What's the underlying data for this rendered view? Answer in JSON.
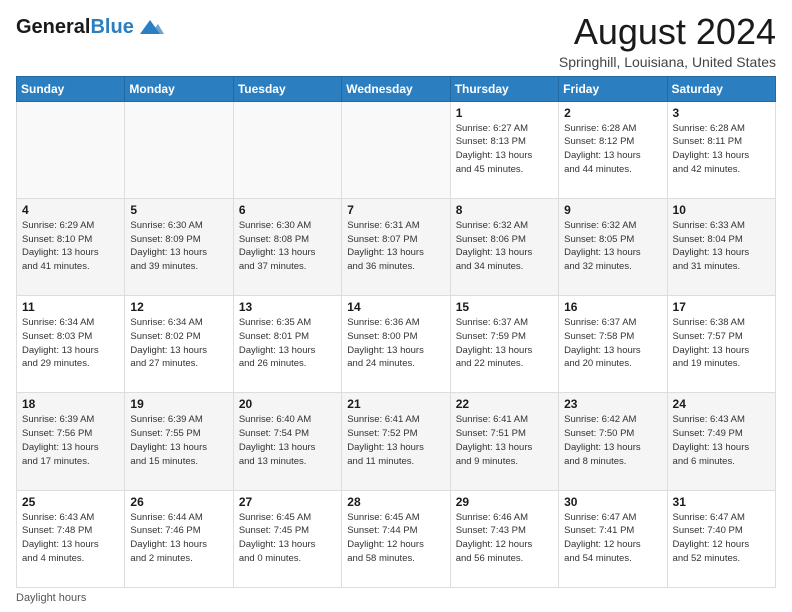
{
  "header": {
    "logo_line1": "General",
    "logo_line2": "Blue",
    "month_title": "August 2024",
    "location": "Springhill, Louisiana, United States"
  },
  "days_of_week": [
    "Sunday",
    "Monday",
    "Tuesday",
    "Wednesday",
    "Thursday",
    "Friday",
    "Saturday"
  ],
  "weeks": [
    [
      {
        "day": "",
        "info": ""
      },
      {
        "day": "",
        "info": ""
      },
      {
        "day": "",
        "info": ""
      },
      {
        "day": "",
        "info": ""
      },
      {
        "day": "1",
        "info": "Sunrise: 6:27 AM\nSunset: 8:13 PM\nDaylight: 13 hours\nand 45 minutes."
      },
      {
        "day": "2",
        "info": "Sunrise: 6:28 AM\nSunset: 8:12 PM\nDaylight: 13 hours\nand 44 minutes."
      },
      {
        "day": "3",
        "info": "Sunrise: 6:28 AM\nSunset: 8:11 PM\nDaylight: 13 hours\nand 42 minutes."
      }
    ],
    [
      {
        "day": "4",
        "info": "Sunrise: 6:29 AM\nSunset: 8:10 PM\nDaylight: 13 hours\nand 41 minutes."
      },
      {
        "day": "5",
        "info": "Sunrise: 6:30 AM\nSunset: 8:09 PM\nDaylight: 13 hours\nand 39 minutes."
      },
      {
        "day": "6",
        "info": "Sunrise: 6:30 AM\nSunset: 8:08 PM\nDaylight: 13 hours\nand 37 minutes."
      },
      {
        "day": "7",
        "info": "Sunrise: 6:31 AM\nSunset: 8:07 PM\nDaylight: 13 hours\nand 36 minutes."
      },
      {
        "day": "8",
        "info": "Sunrise: 6:32 AM\nSunset: 8:06 PM\nDaylight: 13 hours\nand 34 minutes."
      },
      {
        "day": "9",
        "info": "Sunrise: 6:32 AM\nSunset: 8:05 PM\nDaylight: 13 hours\nand 32 minutes."
      },
      {
        "day": "10",
        "info": "Sunrise: 6:33 AM\nSunset: 8:04 PM\nDaylight: 13 hours\nand 31 minutes."
      }
    ],
    [
      {
        "day": "11",
        "info": "Sunrise: 6:34 AM\nSunset: 8:03 PM\nDaylight: 13 hours\nand 29 minutes."
      },
      {
        "day": "12",
        "info": "Sunrise: 6:34 AM\nSunset: 8:02 PM\nDaylight: 13 hours\nand 27 minutes."
      },
      {
        "day": "13",
        "info": "Sunrise: 6:35 AM\nSunset: 8:01 PM\nDaylight: 13 hours\nand 26 minutes."
      },
      {
        "day": "14",
        "info": "Sunrise: 6:36 AM\nSunset: 8:00 PM\nDaylight: 13 hours\nand 24 minutes."
      },
      {
        "day": "15",
        "info": "Sunrise: 6:37 AM\nSunset: 7:59 PM\nDaylight: 13 hours\nand 22 minutes."
      },
      {
        "day": "16",
        "info": "Sunrise: 6:37 AM\nSunset: 7:58 PM\nDaylight: 13 hours\nand 20 minutes."
      },
      {
        "day": "17",
        "info": "Sunrise: 6:38 AM\nSunset: 7:57 PM\nDaylight: 13 hours\nand 19 minutes."
      }
    ],
    [
      {
        "day": "18",
        "info": "Sunrise: 6:39 AM\nSunset: 7:56 PM\nDaylight: 13 hours\nand 17 minutes."
      },
      {
        "day": "19",
        "info": "Sunrise: 6:39 AM\nSunset: 7:55 PM\nDaylight: 13 hours\nand 15 minutes."
      },
      {
        "day": "20",
        "info": "Sunrise: 6:40 AM\nSunset: 7:54 PM\nDaylight: 13 hours\nand 13 minutes."
      },
      {
        "day": "21",
        "info": "Sunrise: 6:41 AM\nSunset: 7:52 PM\nDaylight: 13 hours\nand 11 minutes."
      },
      {
        "day": "22",
        "info": "Sunrise: 6:41 AM\nSunset: 7:51 PM\nDaylight: 13 hours\nand 9 minutes."
      },
      {
        "day": "23",
        "info": "Sunrise: 6:42 AM\nSunset: 7:50 PM\nDaylight: 13 hours\nand 8 minutes."
      },
      {
        "day": "24",
        "info": "Sunrise: 6:43 AM\nSunset: 7:49 PM\nDaylight: 13 hours\nand 6 minutes."
      }
    ],
    [
      {
        "day": "25",
        "info": "Sunrise: 6:43 AM\nSunset: 7:48 PM\nDaylight: 13 hours\nand 4 minutes."
      },
      {
        "day": "26",
        "info": "Sunrise: 6:44 AM\nSunset: 7:46 PM\nDaylight: 13 hours\nand 2 minutes."
      },
      {
        "day": "27",
        "info": "Sunrise: 6:45 AM\nSunset: 7:45 PM\nDaylight: 13 hours\nand 0 minutes."
      },
      {
        "day": "28",
        "info": "Sunrise: 6:45 AM\nSunset: 7:44 PM\nDaylight: 12 hours\nand 58 minutes."
      },
      {
        "day": "29",
        "info": "Sunrise: 6:46 AM\nSunset: 7:43 PM\nDaylight: 12 hours\nand 56 minutes."
      },
      {
        "day": "30",
        "info": "Sunrise: 6:47 AM\nSunset: 7:41 PM\nDaylight: 12 hours\nand 54 minutes."
      },
      {
        "day": "31",
        "info": "Sunrise: 6:47 AM\nSunset: 7:40 PM\nDaylight: 12 hours\nand 52 minutes."
      }
    ]
  ],
  "footer": {
    "note": "Daylight hours"
  }
}
